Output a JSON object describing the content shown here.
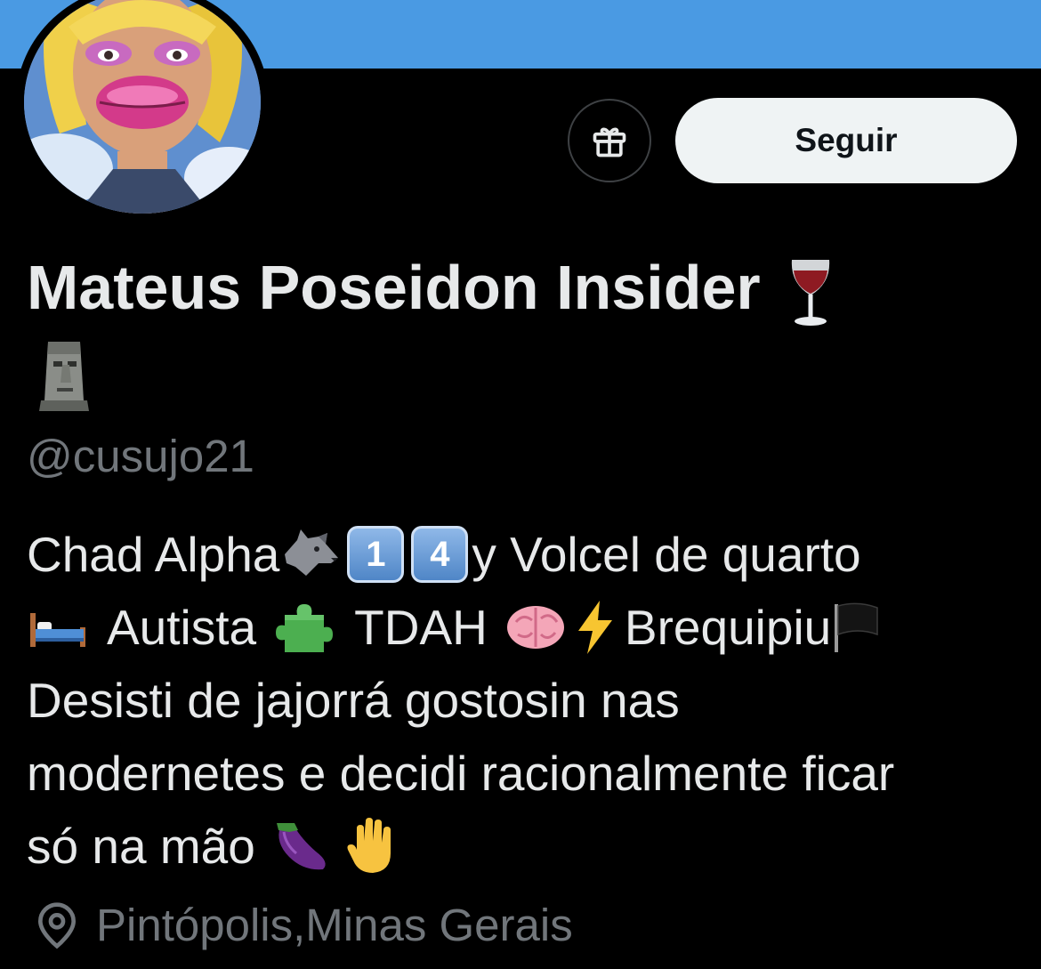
{
  "colors": {
    "banner": "#4a9ae3",
    "background": "#000000",
    "primary_text": "#e7e9ea",
    "secondary_text": "#71767b",
    "follow_button_bg": "#eff3f4"
  },
  "header": {
    "follow_label": "Seguir",
    "gift_icon": "gift-icon",
    "avatar_icon": "profile-avatar"
  },
  "profile": {
    "display_name": "Mateus Poseidon Insider",
    "name_emojis": [
      "wine-glass-icon",
      "moai-icon"
    ],
    "handle": "@cusujo21",
    "bio": {
      "line1_a": "Chad Alpha",
      "key1": "1",
      "key2": "4",
      "line1_b": "y Volcel de quarto",
      "line2_a": "Autista",
      "line2_b": "TDAH",
      "line2_c": "Brequipiu",
      "line3": "Desisti de jajorrá gostosin nas",
      "line4": "modernetes e decidi racionalmente ficar",
      "line5": "só na mão"
    },
    "location": "Pintópolis,Minas Gerais"
  }
}
